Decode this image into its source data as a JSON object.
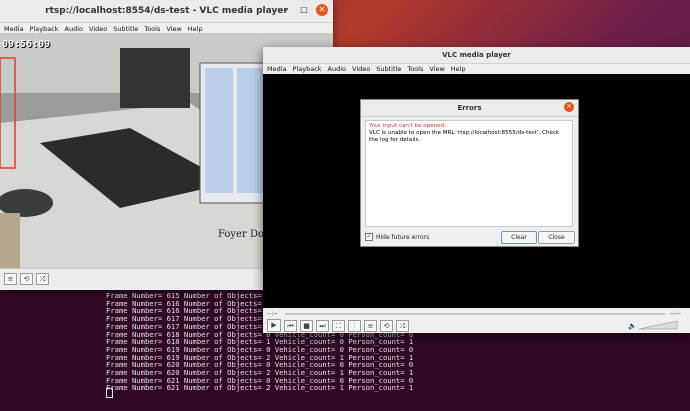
{
  "desktop": {
    "bg": "#9e2d3a"
  },
  "window1": {
    "title": "rtsp://localhost:8554/ds-test - VLC media player",
    "menu": [
      "Media",
      "Playback",
      "Audio",
      "Video",
      "Subtitle",
      "Tools",
      "View",
      "Help"
    ],
    "video": {
      "timestamp": "09:56:09",
      "overlay_label": "Foyer Door"
    }
  },
  "terminal": {
    "lines": [
      "Frame Number= 615 Number of Objects= 3 Vehicle_count= 0 Person_count= 3",
      "Frame Number= 616 Number of Objects= 1 Vehicle_count= 0 Person_count= 1",
      "Frame Number= 616 Number of Objects= 1 Vehicle_count= 0 Person_count= 1",
      "Frame Number= 617 Number of Objects= 0 Vehicle_count= 0 Person_count= 0",
      "Frame Number= 617 Number of Objects= 2 Vehicle_count= 0 Person_count= 2",
      "Frame Number= 618 Number of Objects= 0 Vehicle_count= 0 Person_count= 0",
      "Frame Number= 618 Number of Objects= 1 Vehicle_count= 0 Person_count= 1",
      "Frame Number= 619 Number of Objects= 0 Vehicle_count= 0 Person_count= 0",
      "Frame Number= 619 Number of Objects= 2 Vehicle_count= 1 Person_count= 1",
      "Frame Number= 620 Number of Objects= 0 Vehicle_count= 0 Person_count= 0",
      "Frame Number= 620 Number of Objects= 2 Vehicle_count= 1 Person_count= 1",
      "Frame Number= 621 Number of Objects= 0 Vehicle_count= 0 Person_count= 0",
      "Frame Number= 621 Number of Objects= 2 Vehicle_count= 1 Person_count= 1"
    ]
  },
  "window2": {
    "title": "VLC media player",
    "menu": [
      "Media",
      "Playback",
      "Audio",
      "Video",
      "Subtitle",
      "Tools",
      "View",
      "Help"
    ],
    "time_left": "--:--",
    "time_right": "--:--"
  },
  "dialog": {
    "title": "Errors",
    "error_heading": "Your input can't be opened:",
    "error_body": "VLC is unable to open the MRL 'rtsp://localhost:8555/ds-test'. Check the log for details.",
    "checkbox_label": "Hide future errors",
    "clear_label": "Clear",
    "close_label": "Close"
  }
}
